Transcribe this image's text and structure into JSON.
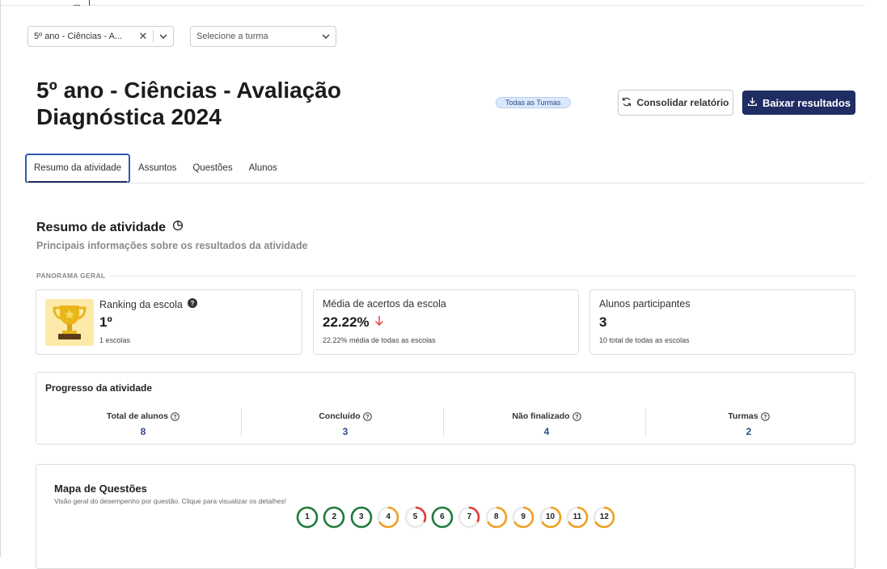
{
  "filters": {
    "activity_select": {
      "value": "5º ano - Ciências - A...",
      "clear": "✕"
    },
    "class_select": {
      "placeholder": "Selecione a turma"
    }
  },
  "header": {
    "title": "5º ano - Ciências - Avaliação Diagnóstica 2024",
    "badge": "Todas as Turmas",
    "consolidate_label": "Consolidar relatório",
    "download_label": "Baixar resultados"
  },
  "tabs": [
    {
      "label": "Resumo da atividade",
      "active": true
    },
    {
      "label": "Assuntos",
      "active": false
    },
    {
      "label": "Questões",
      "active": false
    },
    {
      "label": "Alunos",
      "active": false
    }
  ],
  "summary": {
    "title": "Resumo de atividade",
    "subtitle": "Principais informações sobre os resultados da atividade",
    "section_label": "PANORAMA GERAL"
  },
  "cards": {
    "ranking": {
      "label": "Ranking da escola",
      "value": "1º",
      "note": "1 escolas"
    },
    "average": {
      "label": "Média de acertos da escola",
      "value": "22.22%",
      "note": "22.22% média de todas as escolas",
      "trend": "down"
    },
    "participants": {
      "label": "Alunos participantes",
      "value": "3",
      "note": "10 total de todas as escolas"
    }
  },
  "progress": {
    "title": "Progresso da atividade",
    "columns": [
      {
        "label": "Total de alunos",
        "value": "8"
      },
      {
        "label": "Concluído",
        "value": "3"
      },
      {
        "label": "Não finalizado",
        "value": "4"
      },
      {
        "label": "Turmas",
        "value": "2"
      }
    ]
  },
  "question_map": {
    "title": "Mapa de Questões",
    "subtitle": "Visão geral do desempenho por questão. Clique para visualizar os detalhes!",
    "questions": [
      {
        "number": "1",
        "fraction": 1.0,
        "color": "#1e7a3a"
      },
      {
        "number": "2",
        "fraction": 1.0,
        "color": "#1e7a3a"
      },
      {
        "number": "3",
        "fraction": 1.0,
        "color": "#1e7a3a"
      },
      {
        "number": "4",
        "fraction": 0.67,
        "color": "#f0a020"
      },
      {
        "number": "5",
        "fraction": 0.33,
        "color": "#e03a3a"
      },
      {
        "number": "6",
        "fraction": 1.0,
        "color": "#1e7a3a"
      },
      {
        "number": "7",
        "fraction": 0.33,
        "color": "#e03a3a"
      },
      {
        "number": "8",
        "fraction": 0.67,
        "color": "#f0a020"
      },
      {
        "number": "9",
        "fraction": 0.67,
        "color": "#f0a020"
      },
      {
        "number": "10",
        "fraction": 0.67,
        "color": "#f0a020"
      },
      {
        "number": "11",
        "fraction": 0.67,
        "color": "#f0a020"
      },
      {
        "number": "12",
        "fraction": 0.67,
        "color": "#f0a020"
      }
    ]
  },
  "colors": {
    "primary": "#1f2d63",
    "accent_blue": "#2a4c82",
    "down_arrow": "#e03a3a"
  }
}
